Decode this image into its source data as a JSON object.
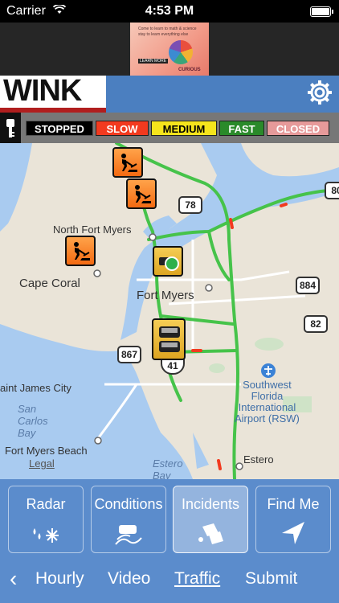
{
  "status": {
    "carrier": "Carrier",
    "time": "4:53 PM"
  },
  "ad": {
    "line1": "Come to learn to math & science",
    "line2": "stay to learn everything else",
    "cta": "LEARN MORE",
    "brand": "CURIOUS"
  },
  "brand": {
    "logo": "WINK",
    "settings_icon": "gear-icon"
  },
  "legend": {
    "stopped": "STOPPED",
    "slow": "SLOW",
    "medium": "MEDIUM",
    "fast": "FAST",
    "closed": "CLOSED",
    "colors": {
      "stopped": "#000000",
      "slow": "#f23a1f",
      "medium": "#f5e41c",
      "fast": "#2a8a2a",
      "closed": "#e69a9a"
    }
  },
  "map": {
    "labels": {
      "north_fort_myers": "North Fort Myers",
      "cape_coral": "Cape Coral",
      "fort_myers": "Fort Myers",
      "saint_james_city": "aint James City",
      "san_carlos_bay": "San\nCarlos\nBay",
      "fort_myers_beach": "Fort Myers Beach",
      "legal": "Legal",
      "estero_bay": "Estero\nBay",
      "estero": "Estero",
      "airport": "Southwest\nFlorida\nInternational\nAirport (RSW)"
    },
    "shields": {
      "r78": "78",
      "r80": "80",
      "r884": "884",
      "r82": "82",
      "r867": "867",
      "r41": "41"
    }
  },
  "tiles": [
    {
      "label": "Radar",
      "icon": "rain-snow-icon"
    },
    {
      "label": "Conditions",
      "icon": "slippery-road-icon"
    },
    {
      "label": "Incidents",
      "icon": "crash-icon"
    },
    {
      "label": "Find Me",
      "icon": "location-arrow-icon"
    }
  ],
  "nav": {
    "back": "‹",
    "hourly": "Hourly",
    "video": "Video",
    "traffic": "Traffic",
    "submit": "Submit"
  }
}
